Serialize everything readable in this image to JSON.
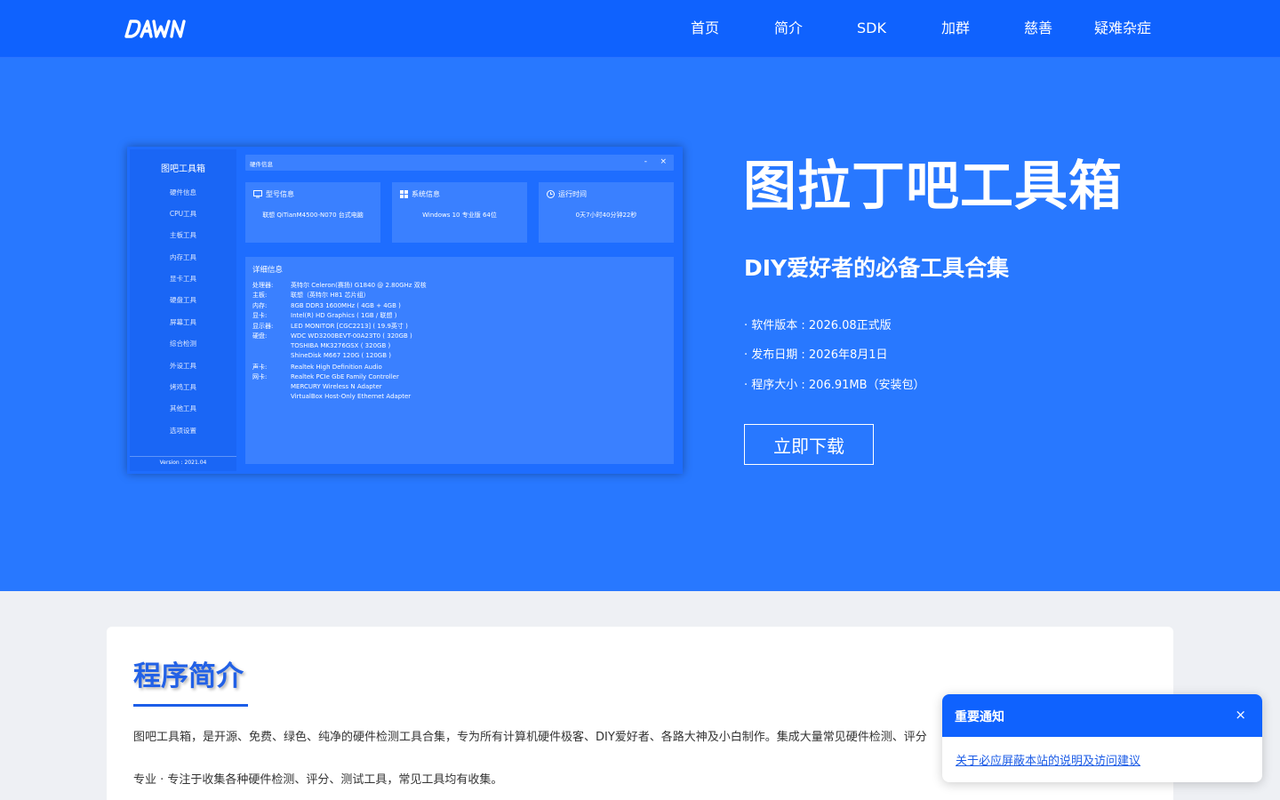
{
  "brand": {
    "logo_text": "DAWN"
  },
  "nav": {
    "items": [
      "首页",
      "简介",
      "SDK",
      "加群",
      "慈善",
      "疑难杂症"
    ]
  },
  "screenshot": {
    "sidebar": {
      "title": "图吧工具箱",
      "items": [
        "硬件信息",
        "CPU工具",
        "主板工具",
        "内存工具",
        "显卡工具",
        "硬盘工具",
        "屏幕工具",
        "综合检测",
        "外设工具",
        "烤鸡工具",
        "其他工具",
        "选项设置"
      ],
      "version": "Version : 2021.04"
    },
    "window_title": "硬件信息",
    "window_min": "-",
    "window_close": "×",
    "cards": [
      {
        "label": "型号信息",
        "value": "联想 QiTianM4500-N070 台式电脑"
      },
      {
        "label": "系统信息",
        "value": "Windows 10 专业版 64位"
      },
      {
        "label": "运行时间",
        "value": "0天7小时40分钟22秒"
      }
    ],
    "detail": {
      "title": "详细信息",
      "rows": [
        {
          "k": "处理器:",
          "v": "英特尔 Celeron(赛扬) G1840 @ 2.80GHz 双核"
        },
        {
          "k": "主板:",
          "v": "联想（英特尔 H81 芯片组）"
        },
        {
          "k": "内存:",
          "v": "8GB DDR3 1600MHz ( 4GB + 4GB )"
        },
        {
          "k": "显卡:",
          "v": "Intel(R) HD Graphics ( 1GB / 联想 )"
        },
        {
          "k": "显示器:",
          "v": "LED MONITOR [CGC2213] ( 19.9英寸 )"
        },
        {
          "k": "硬盘:",
          "v": "WDC WD3200BEVT-00A23T0 ( 320GB )"
        },
        {
          "k": "",
          "v": "TOSHIBA MK3276GSX ( 320GB )"
        },
        {
          "k": "",
          "v": "ShineDisk M667 120G ( 120GB )"
        },
        {
          "k": "声卡:",
          "v": "Realtek High Definition Audio"
        },
        {
          "k": "网卡:",
          "v": "Realtek PCIe GbE Family Controller"
        },
        {
          "k": "",
          "v": "MERCURY Wireless N Adapter"
        },
        {
          "k": "",
          "v": "VirtualBox Host-Only Ethernet Adapter"
        }
      ]
    }
  },
  "hero": {
    "title": "图拉丁吧工具箱",
    "subtitle": "DIY爱好者的必备工具合集",
    "version": "· 软件版本 : 2026.08正式版",
    "date": "· 发布日期 : 2026年8月1日",
    "size": "· 程序大小 : 206.91MB（安装包）",
    "download_label": "立即下载"
  },
  "intro": {
    "title": "程序简介",
    "p1": "图吧工具箱，是开源、免费、绿色、纯净的硬件检测工具合集，专为所有计算机硬件极客、DIY爱好者、各路大神及小白制作。集成大量常见硬件检测、评分",
    "p2": "专业 · 专注于收集各种硬件检测、评分、测试工具，常见工具均有收集。"
  },
  "notice": {
    "title": "重要通知",
    "close": "×",
    "link": "关于必应屏蔽本站的说明及访问建议"
  },
  "colors": {
    "nav_bg": "#0f62fe",
    "hero_bg": "#2878ff",
    "accent": "#2261e6"
  }
}
